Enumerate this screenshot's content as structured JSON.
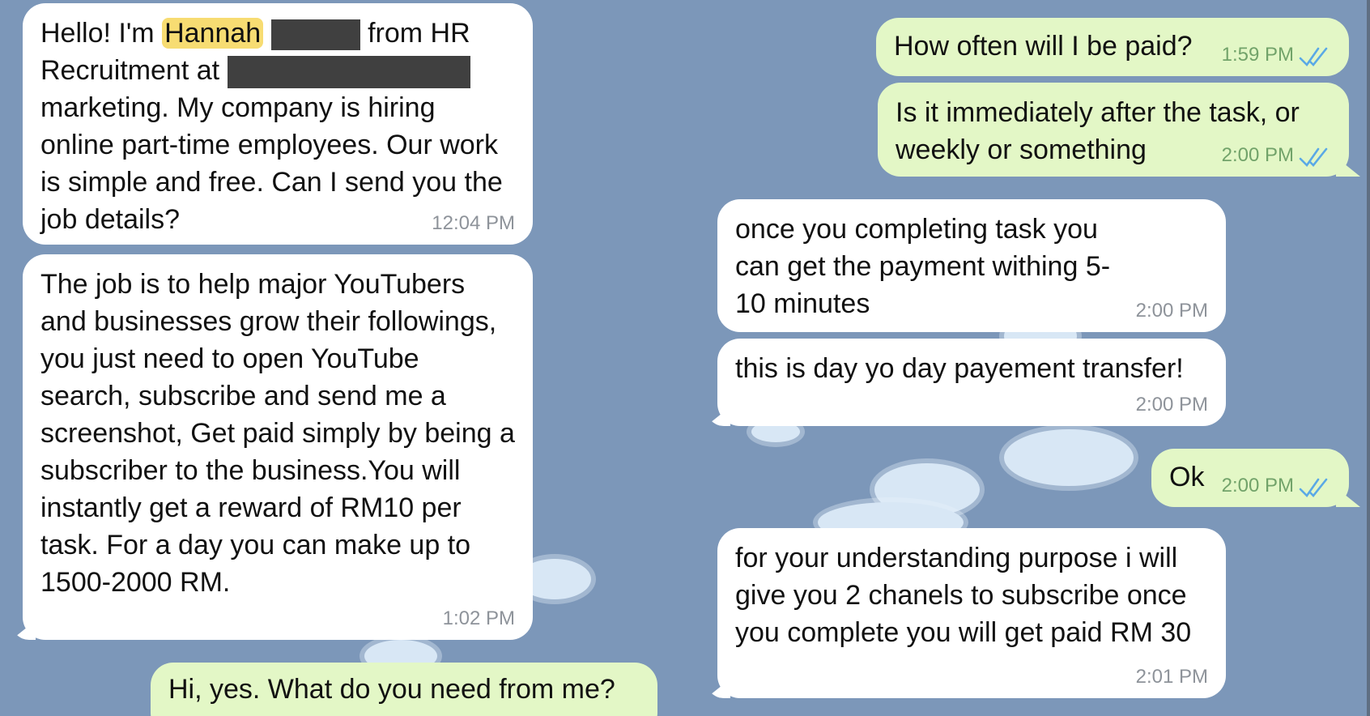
{
  "colors": {
    "background": "#7c97b9",
    "incoming_bubble": "#ffffff",
    "outgoing_bubble": "#e3f7c6",
    "timestamp_in": "#8e939a",
    "timestamp_out": "#72a36a",
    "read_ticks": "#5aa9e6",
    "highlight": "#f7dc72",
    "redaction": "#404040"
  },
  "left": {
    "m1": {
      "greeting": "Hello! I'm",
      "name": "Hannah",
      "from": "from HR",
      "line2": "Recruitment at",
      "rest": "marketing. My company is hiring online part-time employees. Our work is simple and free. Can I send you the job details?",
      "time": "12:04 PM"
    },
    "m2": {
      "text": "The job is to help major YouTubers and businesses grow their followings, you just need to open YouTube search, subscribe and send me a screenshot, Get paid simply by being a subscriber to the business.You will instantly get a reward of RM10 per task. For a day you can make up to 1500-2000 RM.",
      "time": "1:02 PM"
    },
    "m3": {
      "text": "Hi, yes. What do you need from me?"
    }
  },
  "right": {
    "m1": {
      "text": "How often will I be paid?",
      "time": "1:59 PM",
      "icon": "double-check-icon"
    },
    "m2": {
      "text": "Is it immediately after the task, or weekly or something",
      "time": "2:00 PM",
      "icon": "double-check-icon"
    },
    "m3": {
      "text": "once you completing task you can get the payment withing 5-10 minutes",
      "time": "2:00 PM"
    },
    "m4": {
      "text": "this is day yo day payement transfer!",
      "time": "2:00 PM"
    },
    "m5": {
      "text": "Ok",
      "time": "2:00 PM",
      "icon": "double-check-icon"
    },
    "m6": {
      "text": "for your understanding purpose i will give you 2 chanels to subscribe once you complete you will get paid RM 30",
      "time": "2:01 PM"
    }
  }
}
